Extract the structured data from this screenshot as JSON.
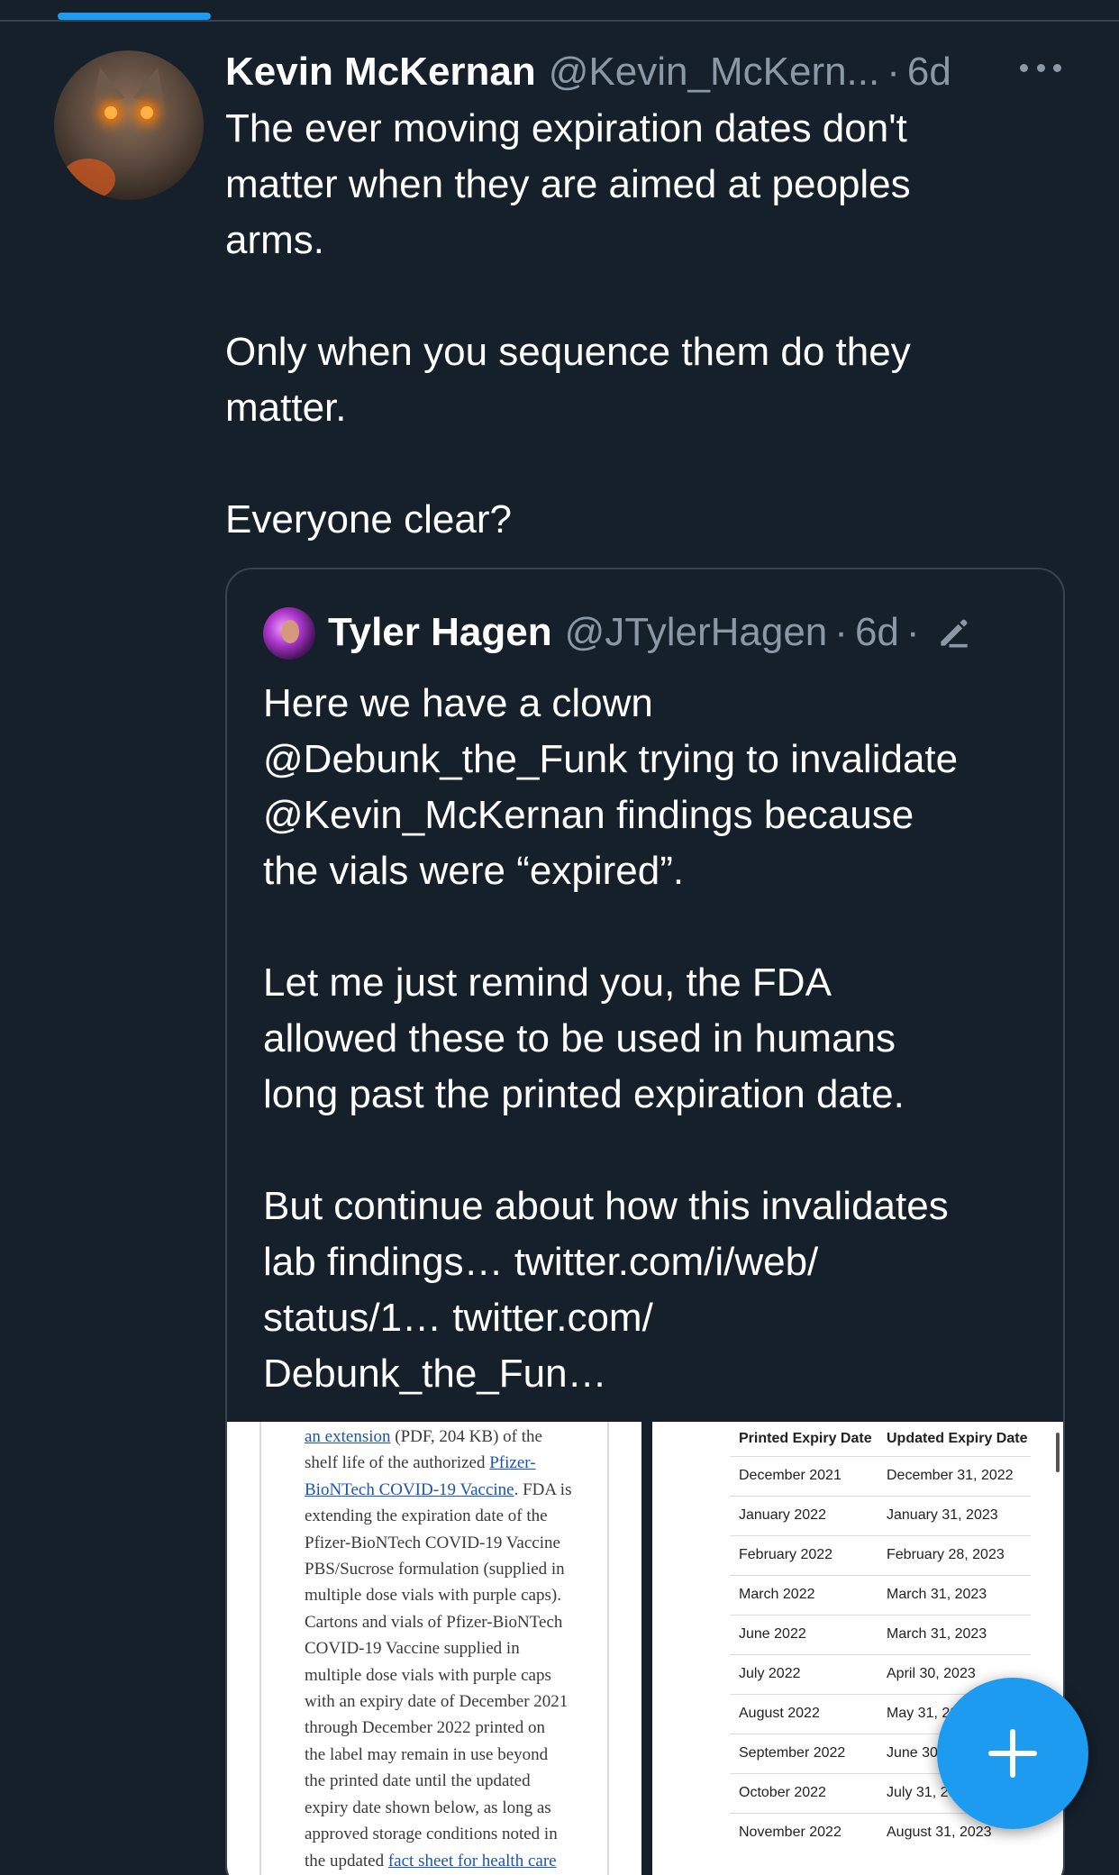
{
  "tweet": {
    "author_name": "Kevin McKernan",
    "author_handle": "@Kevin_McKern...",
    "separator": "·",
    "time": "6d",
    "text_lines": [
      "The ever moving expiration dates don't",
      "matter when they are aimed at peoples",
      "arms.",
      "",
      "Only when you sequence them do they",
      "matter.",
      "",
      "Everyone clear?"
    ]
  },
  "quote": {
    "author_name": "Tyler Hagen",
    "author_handle": "@JTylerHagen",
    "time": "6d",
    "separator": "·",
    "text_lines": [
      "Here we have a clown",
      "@Debunk_the_Funk trying to invalidate",
      "@Kevin_McKernan findings because",
      "the vials were “expired”.",
      "",
      "Let me just remind you, the FDA",
      "allowed these to be used in humans",
      "long past the printed expiration date.",
      "",
      "But continue about how this invalidates",
      "lab findings… twitter.com/i/web/",
      "status/1… twitter.com/",
      "Debunk_the_Fun…"
    ]
  },
  "media_left": {
    "link1": "an extension",
    "line1_rest": " (PDF, 204 KB) of the",
    "line2": "shelf life of the authorized ",
    "link2a": "Pfizer-",
    "link2b": "BioNTech COVID-19 Vaccine",
    "line3_rest": ". FDA is",
    "body_lines": [
      "extending the expiration date of the",
      "Pfizer-BioNTech COVID-19 Vaccine",
      "PBS/Sucrose formulation (supplied in",
      "multiple dose vials with purple caps).",
      "Cartons and vials of Pfizer-BioNTech",
      "COVID-19 Vaccine supplied in",
      "multiple dose vials with purple caps",
      "with an expiry date of December 2021",
      "through December 2022 printed on",
      "the label may remain in use beyond",
      "the printed date until the updated",
      "expiry date shown below, as long as",
      "approved storage conditions noted in"
    ],
    "last_line_start": "the updated ",
    "last_link": "fact sheet for health care"
  },
  "media_right": {
    "headers": [
      "Printed Expiry Date",
      "Updated Expiry Date"
    ],
    "rows": [
      [
        "December 2021",
        "December 31, 2022"
      ],
      [
        "January 2022",
        "January 31, 2023"
      ],
      [
        "February 2022",
        "February 28, 2023"
      ],
      [
        "March 2022",
        "March 31, 2023"
      ],
      [
        "June 2022",
        "March 31, 2023"
      ],
      [
        "July 2022",
        "April 30, 2023"
      ],
      [
        "August 2022",
        "May 31, 20"
      ],
      [
        "September 2022",
        "June 30,"
      ],
      [
        "October 2022",
        "July 31, 20"
      ],
      [
        "November 2022",
        "August 31, 2023"
      ]
    ]
  },
  "colors": {
    "background": "#15202b",
    "accent": "#1d9bf0",
    "secondary_text": "#8b98a5",
    "border": "#38444d"
  },
  "icons": [
    "more-icon",
    "edit-icon",
    "compose-plus-icon"
  ]
}
